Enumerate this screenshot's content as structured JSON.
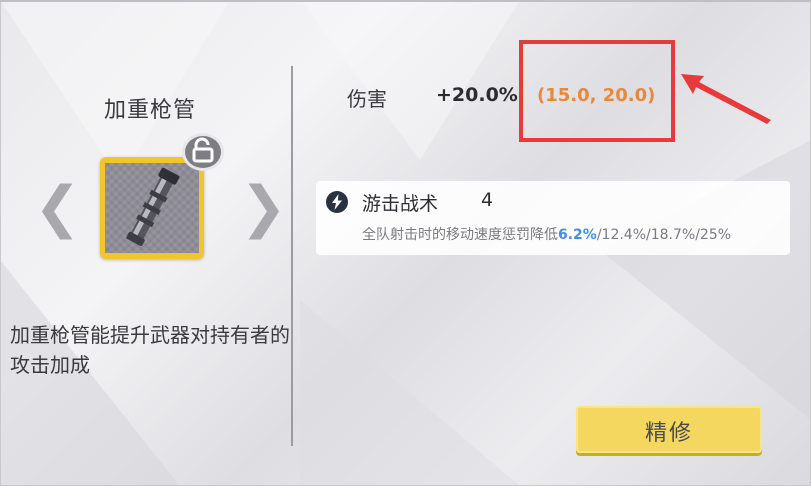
{
  "item": {
    "name": "加重枪管",
    "description": "加重枪管能提升武器对持有者的攻击加成"
  },
  "stat": {
    "label": "伤害",
    "value": "+20.0%",
    "range": "(15.0, 20.0)"
  },
  "skill": {
    "name": "游击战术",
    "level": "4",
    "desc_prefix": "全队射击时的移动速度惩罚降低",
    "current_value": "6.2%",
    "other_values": "/12.4%/18.7%/25%"
  },
  "nav": {
    "prev_glyph": "❮",
    "next_glyph": "❯"
  },
  "actions": {
    "refine_label": "精修"
  },
  "icons": {
    "lock": "unlock-icon",
    "skill": "lightning-icon"
  },
  "colors": {
    "card_frame": "#f1c62c",
    "range_text": "#e8883a",
    "highlight": "#e8393d",
    "current_value": "#3f8ee8",
    "button": "#f3d75e"
  }
}
